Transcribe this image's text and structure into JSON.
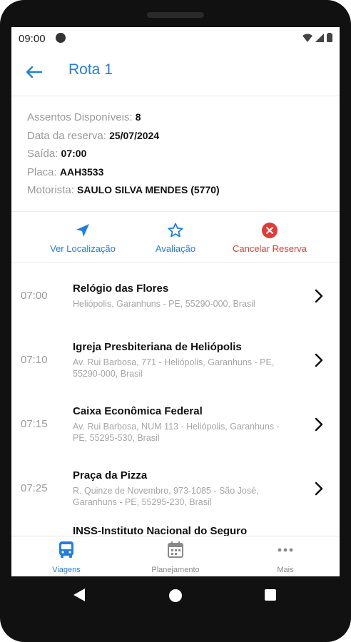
{
  "status": {
    "time": "09:00"
  },
  "appbar": {
    "title": "Rota 1"
  },
  "info": {
    "seats_label": "Assentos Disponíveis:",
    "seats_value": "8",
    "date_label": "Data da reserva:",
    "date_value": "25/07/2024",
    "departure_label": "Saída:",
    "departure_value": "07:00",
    "plate_label": "Placa:",
    "plate_value": "AAH3533",
    "driver_label": "Motorista:",
    "driver_value": "SAULO SILVA MENDES (5770)"
  },
  "actions": [
    {
      "label": "Ver Localização",
      "icon": "navigation-arrow-icon",
      "color": "#1f7fe0"
    },
    {
      "label": "Avaliação",
      "icon": "star-outline-icon",
      "color": "#1f7fe0"
    },
    {
      "label": "Cancelar Reserva",
      "icon": "cancel-circle-icon",
      "color": "#e53935"
    }
  ],
  "stops": [
    {
      "time": "07:00",
      "name": "Relógio das Flores",
      "address": "Heliópolis, Garanhuns - PE, 55290-000, Brasil"
    },
    {
      "time": "07:10",
      "name": "Igreja Presbiteriana de Heliópolis",
      "address": "Av. Rui Barbosa, 771 - Heliópolis, Garanhuns - PE, 55290-000, Brasil"
    },
    {
      "time": "07:15",
      "name": "Caixa Econômica Federal",
      "address": "Av. Rui Barbosa, NUM 113 - Heliópolis, Garanhuns - PE, 55295-530, Brasil"
    },
    {
      "time": "07:25",
      "name": "Praça da Pizza",
      "address": "R. Quinze de Novembro, 973-1085 - São José, Garanhuns - PE, 55295-230, Brasil"
    },
    {
      "time": "",
      "name": "INSS-Instituto Nacional do Seguro",
      "address": ""
    }
  ],
  "nav": [
    {
      "label": "Viagens",
      "icon": "bus-icon",
      "active": true
    },
    {
      "label": "Planejamento",
      "icon": "calendar-icon",
      "active": false
    },
    {
      "label": "Mais",
      "icon": "more-dots-icon",
      "active": false
    }
  ],
  "colors": {
    "accent": "#1f7fe0",
    "danger": "#e53935",
    "muted": "#9a9a9a"
  }
}
